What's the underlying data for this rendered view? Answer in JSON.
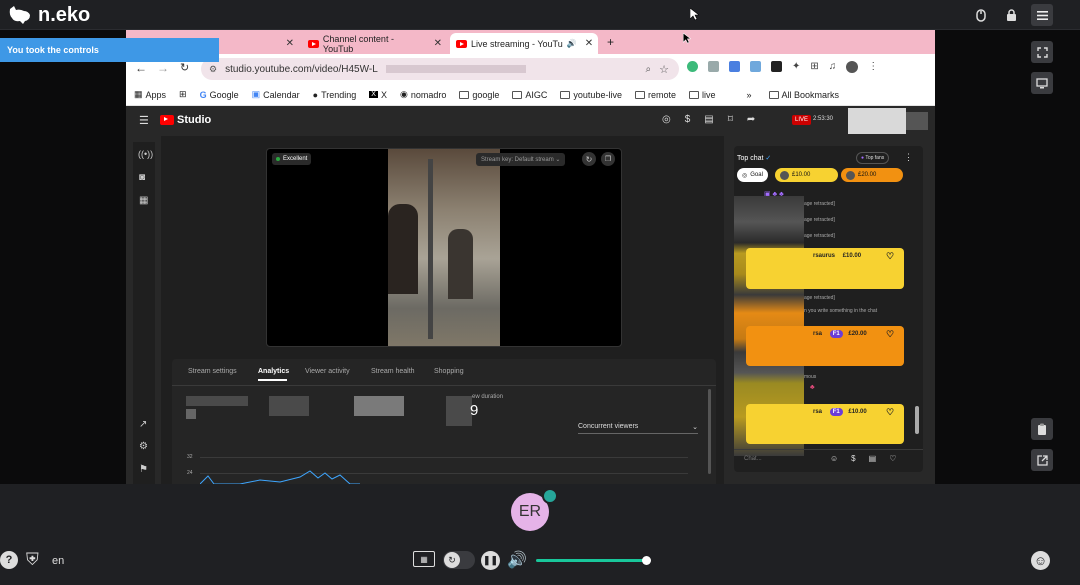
{
  "neko": {
    "brand": "n.eko",
    "toast": "You took the controls",
    "lang": "en",
    "user_initials": "ER",
    "volume_percent": 100
  },
  "browser": {
    "tabs": [
      {
        "label": "",
        "active": false
      },
      {
        "label": "Channel content - YouTub",
        "active": false
      },
      {
        "label": "Live streaming - YouTu",
        "active": true
      }
    ],
    "url": "studio.youtube.com/video/H45W-L",
    "bookmarks": [
      "Apps",
      "Google",
      "Calendar",
      "Trending",
      "X",
      "nomadro",
      "google",
      "AIGC",
      "youtube-live",
      "remote",
      "live"
    ],
    "all_bookmarks": "All Bookmarks"
  },
  "studio": {
    "logo": "Studio",
    "live_badge": "LIVE",
    "live_time": "2:53:30",
    "preview": {
      "health": "Excellent",
      "stream_key": "Stream key: Default stream"
    },
    "analytics": {
      "tabs": [
        "Stream settings",
        "Analytics",
        "Viewer activity",
        "Stream health",
        "Shopping"
      ],
      "selected_tab": "Analytics",
      "watch_label": "ew duration",
      "watch_value": "9",
      "dropdown": "Concurrent viewers",
      "y_ticks": [
        "32",
        "24"
      ]
    },
    "chat": {
      "title": "Top chat",
      "top_fans": "Top fans",
      "chips": [
        "Goal",
        "£10.00",
        "£20.00"
      ],
      "lines": [
        {
          "text": "age retracted]"
        },
        {
          "text": "age retracted]"
        },
        {
          "text": "age retracted]"
        },
        {
          "text": "age retracted]"
        },
        {
          "text": "n you write something in the chat"
        },
        {
          "text": "mous"
        }
      ],
      "superchats": [
        {
          "name": "rsaurus",
          "amount": "£10.00",
          "color": "yellow"
        },
        {
          "name": "rsa",
          "badge": "F1",
          "amount": "£20.00",
          "color": "orange"
        },
        {
          "name": "rsa",
          "badge": "F1",
          "amount": "£10.00",
          "color": "yellow"
        }
      ],
      "input_placeholder": "Chat..."
    }
  }
}
